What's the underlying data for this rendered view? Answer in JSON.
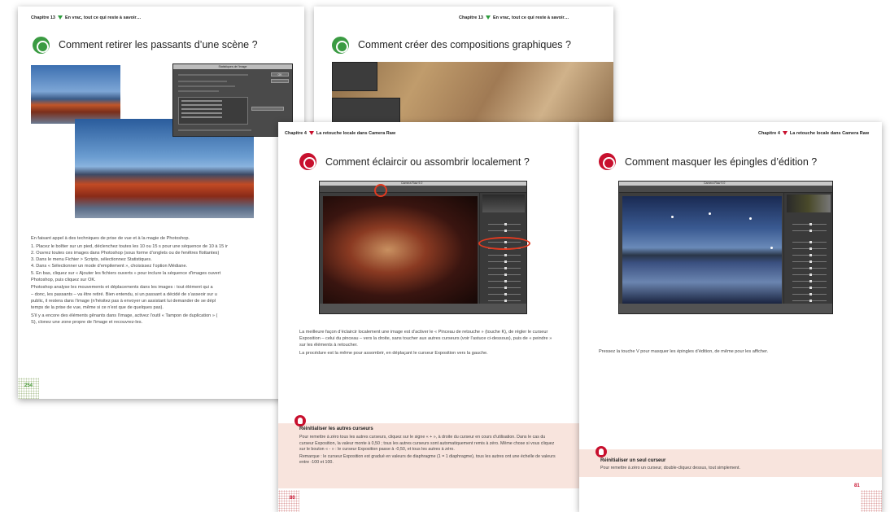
{
  "page_a": {
    "chapter_num": "Chapitre 13",
    "chapter_title": "En vrac, tout ce qui reste à savoir…",
    "title": "Comment retirer les passants d’une scène ?",
    "dialog_title": "Statistiques de l'image",
    "dialog_ok": "OK",
    "paragraphs": [
      "En faisant appel à des techniques de prise de vue et à la magie de Photoshop.",
      "1. Placez le boîtier sur un pied, déclenchez toutes les 10 ou 15 s pour une séquence de 10 à 15 ir",
      "2. Ouvrez toutes ces images dans Photoshop (sous forme d’onglets ou de fenêtres flottantes)",
      "3. Dans le menu Fichier > Scripts, sélectionnez Statistiques.",
      "4. Dans « Sélectionner un mode d’empilement », choisissez l’option Médiane.",
      "5. En bas, cliquez sur « Ajouter les fichiers ouverts » pour inclure la séquence d’images ouvert",
      "    Photoshop, puis cliquez sur OK.",
      "Photoshop analyse les mouvements et déplacements dans les images : tout élément qui a",
      "– donc, les passants – va être retiré. Bien entendu, si un passant a décidé de s’asseoir sur u",
      "public, il restera dans l’image (n’hésitez pas à envoyer un assistant lui demander de se dépl",
      "temps de la prise de vue, même si ce n’est que de quelques pas).",
      "S’il y a encore des éléments gênants dans l’image, activez l’outil « Tampon de duplication » (",
      "S), clonez une zone propre de l’image et recouvrez-les."
    ],
    "page_number": "254"
  },
  "page_b": {
    "chapter_num": "Chapitre 13",
    "chapter_title": "En vrac, tout ce qui reste à savoir…",
    "title": "Comment créer des compositions graphiques ?"
  },
  "page_c": {
    "chapter_num": "Chapitre 4",
    "chapter_title": "La retouche locale dans Camera Raw",
    "title": "Comment éclaircir ou assombrir localement ?",
    "window_title": "Camera Raw 9.0",
    "paragraphs": [
      "La meilleure façon d’éclaircir localement une image est d’activer le « Pinceau de retouche » (touche K), de régler le curseur Exposition – celui du pinceau – vers la droite, sans toucher aux autres curseurs (voir l’astuce ci-dessous), puis de « peindre » sur les éléments à retoucher.",
      "La procédure est la même pour assombrir, en déplaçant le curseur Exposition vers la gauche."
    ],
    "tip_title": "Réinitialiser les autres curseurs",
    "tip_paragraphs": [
      "Pour remettre à zéro tous les autres curseurs, cliquez sur le signe « + », à droite du curseur en cours d’utilisation. Dans le cas du curseur Exposition, la valeur monte à 0,50 ; tous les autres curseurs sont automatiquement remis à zéro. Même chose si vous cliquez sur le bouton « - » : le curseur Exposition passe à -0,50, et tous les autres à zéro.",
      "Remarque : le curseur Exposition est gradué en valeurs de diaphragme (1 = 1 diaphragme), tous les autres ont une échelle de valeurs entre -100 et 100."
    ],
    "page_number": "80"
  },
  "page_d": {
    "chapter_num": "Chapitre 4",
    "chapter_title": "La retouche locale dans Camera Raw",
    "title": "Comment masquer les épingles d’édition ?",
    "window_title": "Camera Raw 9.0",
    "paragraph": "Pressez la touche V pour masquer les épingles d’édition, de même pour les afficher.",
    "tip_title": "Réinitialiser un seul curseur",
    "tip_body": "Pour remettre à zéro un curseur, double-cliquez dessus, tout simplement.",
    "page_number": "81"
  }
}
